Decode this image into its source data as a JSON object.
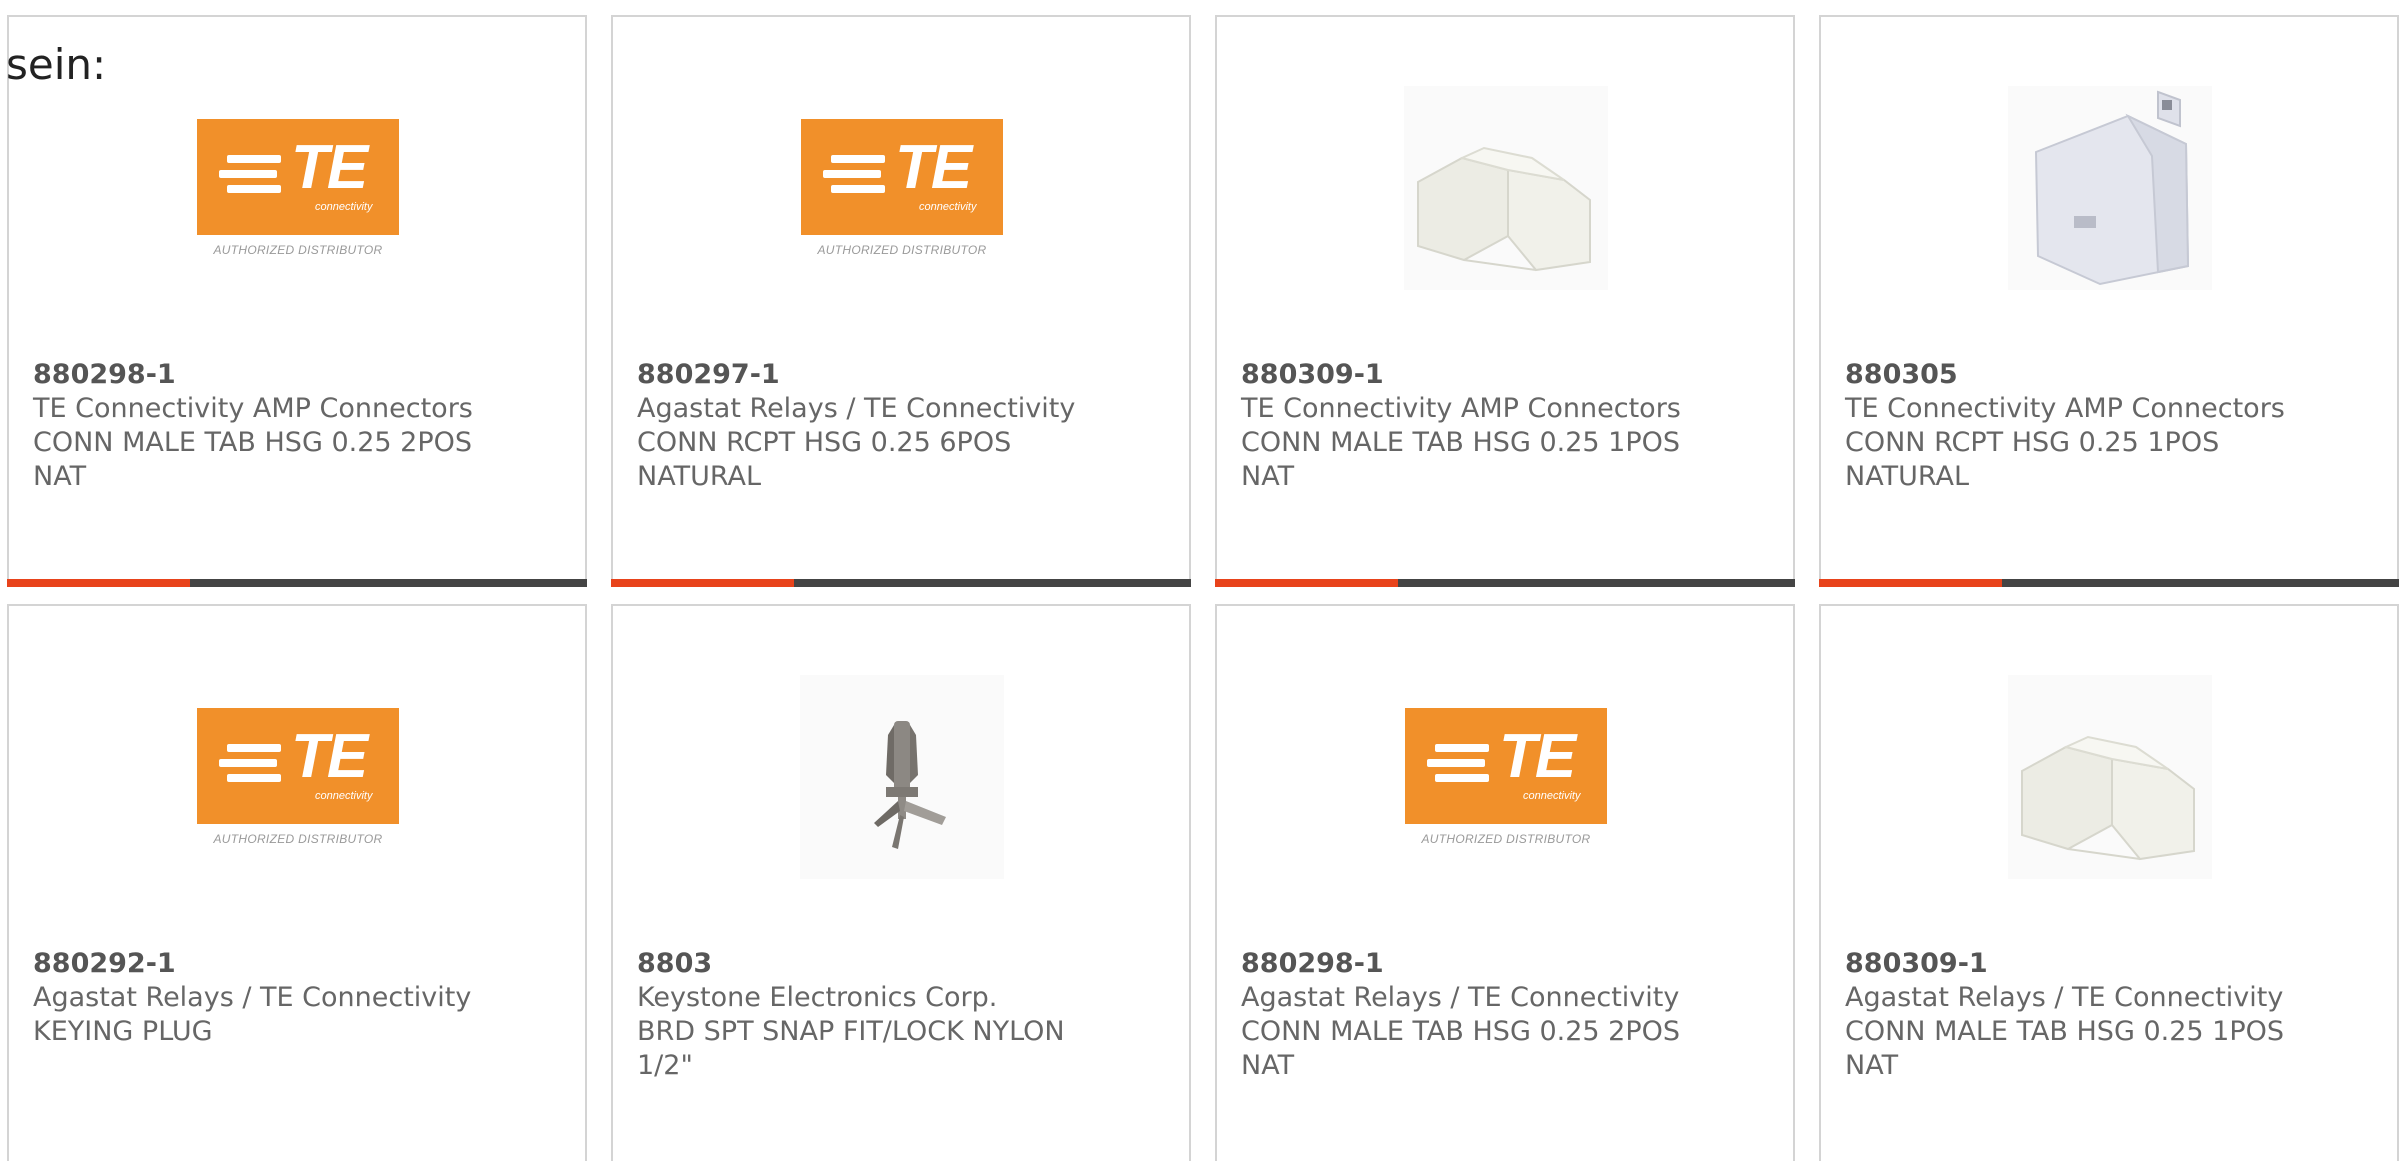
{
  "intro_text": "sein:",
  "colors": {
    "accent": "#e8431b",
    "bar": "#444444",
    "brand_orange": "#f1902a"
  },
  "brand_logo": {
    "text": "TE",
    "subtext": "connectivity",
    "tagline": "AUTHORIZED DISTRIBUTOR"
  },
  "products": [
    {
      "part_number": "880298-1",
      "manufacturer": "TE Connectivity AMP Connectors",
      "desc_line1": "CONN MALE TAB HSG 0.25 2POS",
      "desc_line2": "NAT",
      "image": "te-logo"
    },
    {
      "part_number": "880297-1",
      "manufacturer": "Agastat Relays / TE Connectivity",
      "desc_line1": "CONN RCPT HSG 0.25 6POS",
      "desc_line2": "NATURAL",
      "image": "te-logo"
    },
    {
      "part_number": "880309-1",
      "manufacturer": "TE Connectivity AMP Connectors",
      "desc_line1": "CONN MALE TAB HSG 0.25 1POS",
      "desc_line2": "NAT",
      "image": "connector-housing-photo"
    },
    {
      "part_number": "880305",
      "manufacturer": "TE Connectivity AMP Connectors",
      "desc_line1": "CONN RCPT HSG 0.25 1POS",
      "desc_line2": "NATURAL",
      "image": "receptacle-housing-photo"
    },
    {
      "part_number": "880292-1",
      "manufacturer": "Agastat Relays / TE Connectivity",
      "desc_line1": "KEYING PLUG",
      "desc_line2": "",
      "image": "te-logo"
    },
    {
      "part_number": "8803",
      "manufacturer": "Keystone Electronics Corp.",
      "desc_line1": "BRD SPT SNAP FIT/LOCK NYLON",
      "desc_line2": "1/2\"",
      "image": "board-support-photo"
    },
    {
      "part_number": "880298-1",
      "manufacturer": "Agastat Relays / TE Connectivity",
      "desc_line1": "CONN MALE TAB HSG 0.25 2POS",
      "desc_line2": "NAT",
      "image": "te-logo"
    },
    {
      "part_number": "880309-1",
      "manufacturer": "Agastat Relays / TE Connectivity",
      "desc_line1": "CONN MALE TAB HSG 0.25 1POS",
      "desc_line2": "NAT",
      "image": "connector-housing-photo"
    }
  ]
}
